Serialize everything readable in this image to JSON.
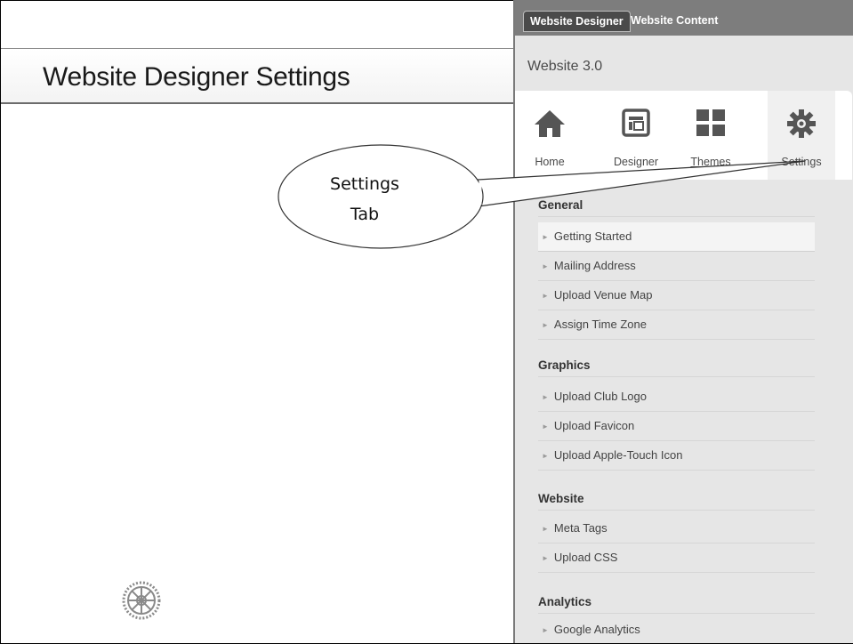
{
  "slide": {
    "title": "Website Designer Settings",
    "callout_line1": "Settings",
    "callout_line2": "Tab",
    "logo_icon": "rotary-wheel-icon"
  },
  "panel": {
    "tabs": [
      {
        "label": "Website Designer",
        "active": true
      },
      {
        "label": "Website Content",
        "active": false
      }
    ],
    "site_title": "Website 3.0",
    "icons": [
      {
        "label": "Home",
        "icon": "home-icon"
      },
      {
        "label": "Designer",
        "icon": "designer-icon"
      },
      {
        "label": "Themes",
        "icon": "themes-icon"
      },
      {
        "label": "Settings",
        "icon": "gear-icon"
      }
    ],
    "sections": [
      {
        "heading": "General",
        "items": [
          "Getting Started",
          "Mailing Address",
          "Upload Venue Map",
          "Assign Time Zone"
        ]
      },
      {
        "heading": "Graphics",
        "items": [
          "Upload Club Logo",
          "Upload Favicon",
          "Upload Apple-Touch Icon"
        ]
      },
      {
        "heading": "Website",
        "items": [
          "Meta Tags",
          "Upload CSS"
        ]
      },
      {
        "heading": "Analytics",
        "items": [
          "Google Analytics"
        ]
      }
    ]
  },
  "colors": {
    "panel_bg": "#e6e6e6",
    "tab_bar": "#7d7d7d",
    "active_tab": "#4a4a4a"
  }
}
